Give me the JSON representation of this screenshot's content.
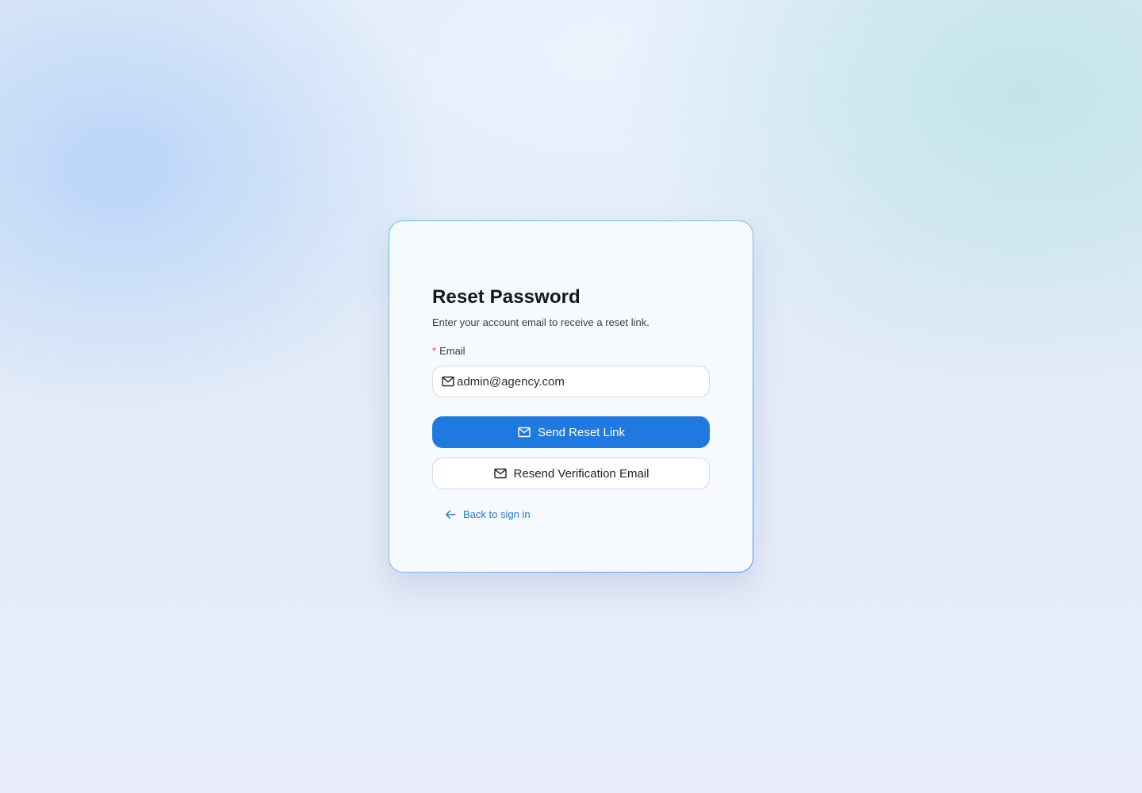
{
  "page": {
    "title": "Reset Password",
    "subtitle": "Enter your account email to receive a reset link."
  },
  "form": {
    "email": {
      "required_mark": "*",
      "label": "Email",
      "value": "admin@agency.com",
      "icon": "mail-icon"
    }
  },
  "actions": {
    "send_reset_label": "Send Reset Link",
    "send_reset_icon": "mail-icon",
    "resend_verification_label": "Resend Verification Email",
    "resend_verification_icon": "mail-icon",
    "back_label": "Back to sign in",
    "back_icon": "arrow-left-icon"
  },
  "colors": {
    "primary": "#1e7ae0",
    "link": "#2478d6",
    "required": "#e0463a",
    "title": "#13161c"
  }
}
